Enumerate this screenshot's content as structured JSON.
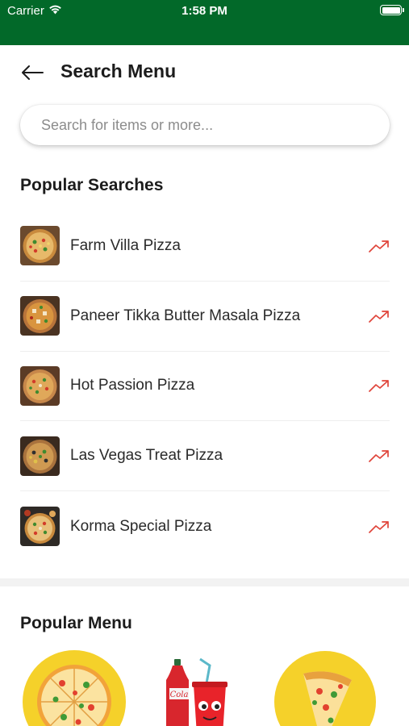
{
  "status_bar": {
    "carrier": "Carrier",
    "time": "1:58 PM",
    "wifi_icon": "wifi-icon",
    "battery_icon": "battery-icon",
    "background_color": "#026929"
  },
  "header": {
    "back_icon": "arrow-left-icon",
    "title": "Search Menu"
  },
  "search": {
    "placeholder": "Search for items or more...",
    "value": ""
  },
  "popular_searches": {
    "title": "Popular Searches",
    "trend_icon": "trending-up-icon",
    "trend_color": "#e0443a",
    "items": [
      {
        "label": "Farm Villa Pizza"
      },
      {
        "label": "Paneer Tikka Butter Masala Pizza"
      },
      {
        "label": "Hot Passion Pizza"
      },
      {
        "label": "Las Vegas Treat Pizza"
      },
      {
        "label": "Korma Special Pizza"
      }
    ]
  },
  "popular_menu": {
    "title": "Popular Menu",
    "tiles": [
      {
        "icon": "pizza-icon"
      },
      {
        "icon": "cola-drinks-icon",
        "text": "Cola"
      },
      {
        "icon": "pizza-slice-icon"
      }
    ]
  }
}
